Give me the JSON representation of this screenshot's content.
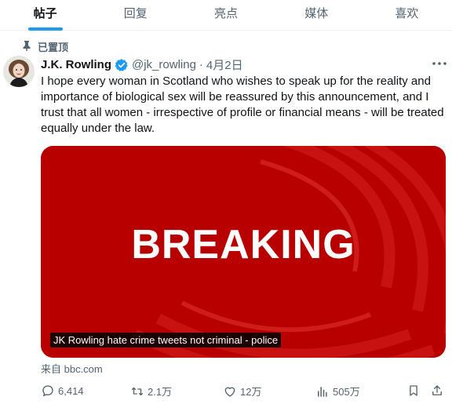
{
  "tabs": [
    {
      "label": "帖子",
      "active": true
    },
    {
      "label": "回复",
      "active": false
    },
    {
      "label": "亮点",
      "active": false
    },
    {
      "label": "媒体",
      "active": false
    },
    {
      "label": "喜欢",
      "active": false
    }
  ],
  "pinned_label": "已置顶",
  "tweet": {
    "display_name": "J.K. Rowling",
    "handle": "@jk_rowling",
    "separator": "·",
    "date": "4月2日",
    "text": "I hope every woman in Scotland who wishes to speak up for the reality and importance of biological sex will be reassured by this announcement, and I trust that all women - irrespective of profile or financial means - will be treated equally under the law.",
    "media": {
      "headline": "BREAKING",
      "caption": "JK Rowling hate crime tweets not criminal - police"
    },
    "source": "来自 bbc.com",
    "stats": {
      "replies": "6,414",
      "reposts": "2.1万",
      "likes": "12万",
      "views": "505万"
    }
  },
  "colors": {
    "accent": "#1d9bf0",
    "breaking_red": "#b80000",
    "muted_text": "#536471"
  },
  "icons": [
    "pin-icon",
    "verified-badge-icon",
    "more-icon",
    "reply-icon",
    "repost-icon",
    "like-icon",
    "views-icon",
    "bookmark-icon",
    "share-icon"
  ]
}
